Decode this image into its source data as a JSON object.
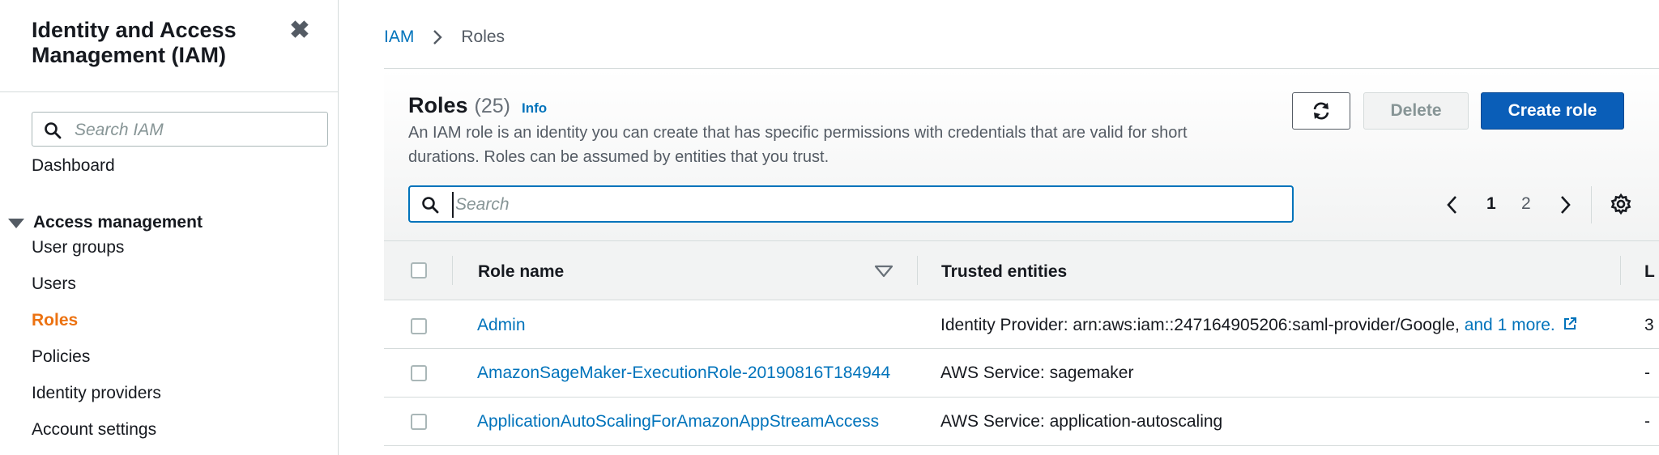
{
  "sidebar": {
    "title": "Identity and Access Management (IAM)",
    "close_glyph": "✖",
    "search_placeholder": "Search IAM",
    "dashboard": "Dashboard",
    "section": "Access management",
    "items": [
      {
        "label": "User groups",
        "active": false
      },
      {
        "label": "Users",
        "active": false
      },
      {
        "label": "Roles",
        "active": true
      },
      {
        "label": "Policies",
        "active": false
      },
      {
        "label": "Identity providers",
        "active": false
      },
      {
        "label": "Account settings",
        "active": false
      }
    ]
  },
  "breadcrumb": {
    "root": "IAM",
    "current": "Roles"
  },
  "header": {
    "title": "Roles",
    "count": "(25)",
    "info": "Info",
    "description": "An IAM role is an identity you can create that has specific permissions with credentials that are valid for short durations. Roles can be assumed by entities that you trust."
  },
  "actions": {
    "delete": "Delete",
    "create": "Create role"
  },
  "search": {
    "placeholder": "Search"
  },
  "pagination": {
    "pages": [
      "1",
      "2"
    ],
    "current": "1"
  },
  "table": {
    "columns": [
      "Role name",
      "Trusted entities",
      "L"
    ],
    "rows": [
      {
        "name": "Admin",
        "trusted": "Identity Provider: arn:aws:iam::247164905206:saml-provider/Google,",
        "more": "and 1 more.",
        "last": "3"
      },
      {
        "name": "AmazonSageMaker-ExecutionRole-20190816T184944",
        "trusted": "AWS Service: sagemaker",
        "more": "",
        "last": "-"
      },
      {
        "name": "ApplicationAutoScalingForAmazonAppStreamAccess",
        "trusted": "AWS Service: application-autoscaling",
        "more": "",
        "last": "-"
      }
    ]
  },
  "colors": {
    "link": "#0073bb",
    "active_nav": "#ec7211",
    "primary_button": "#0a5eb8"
  }
}
